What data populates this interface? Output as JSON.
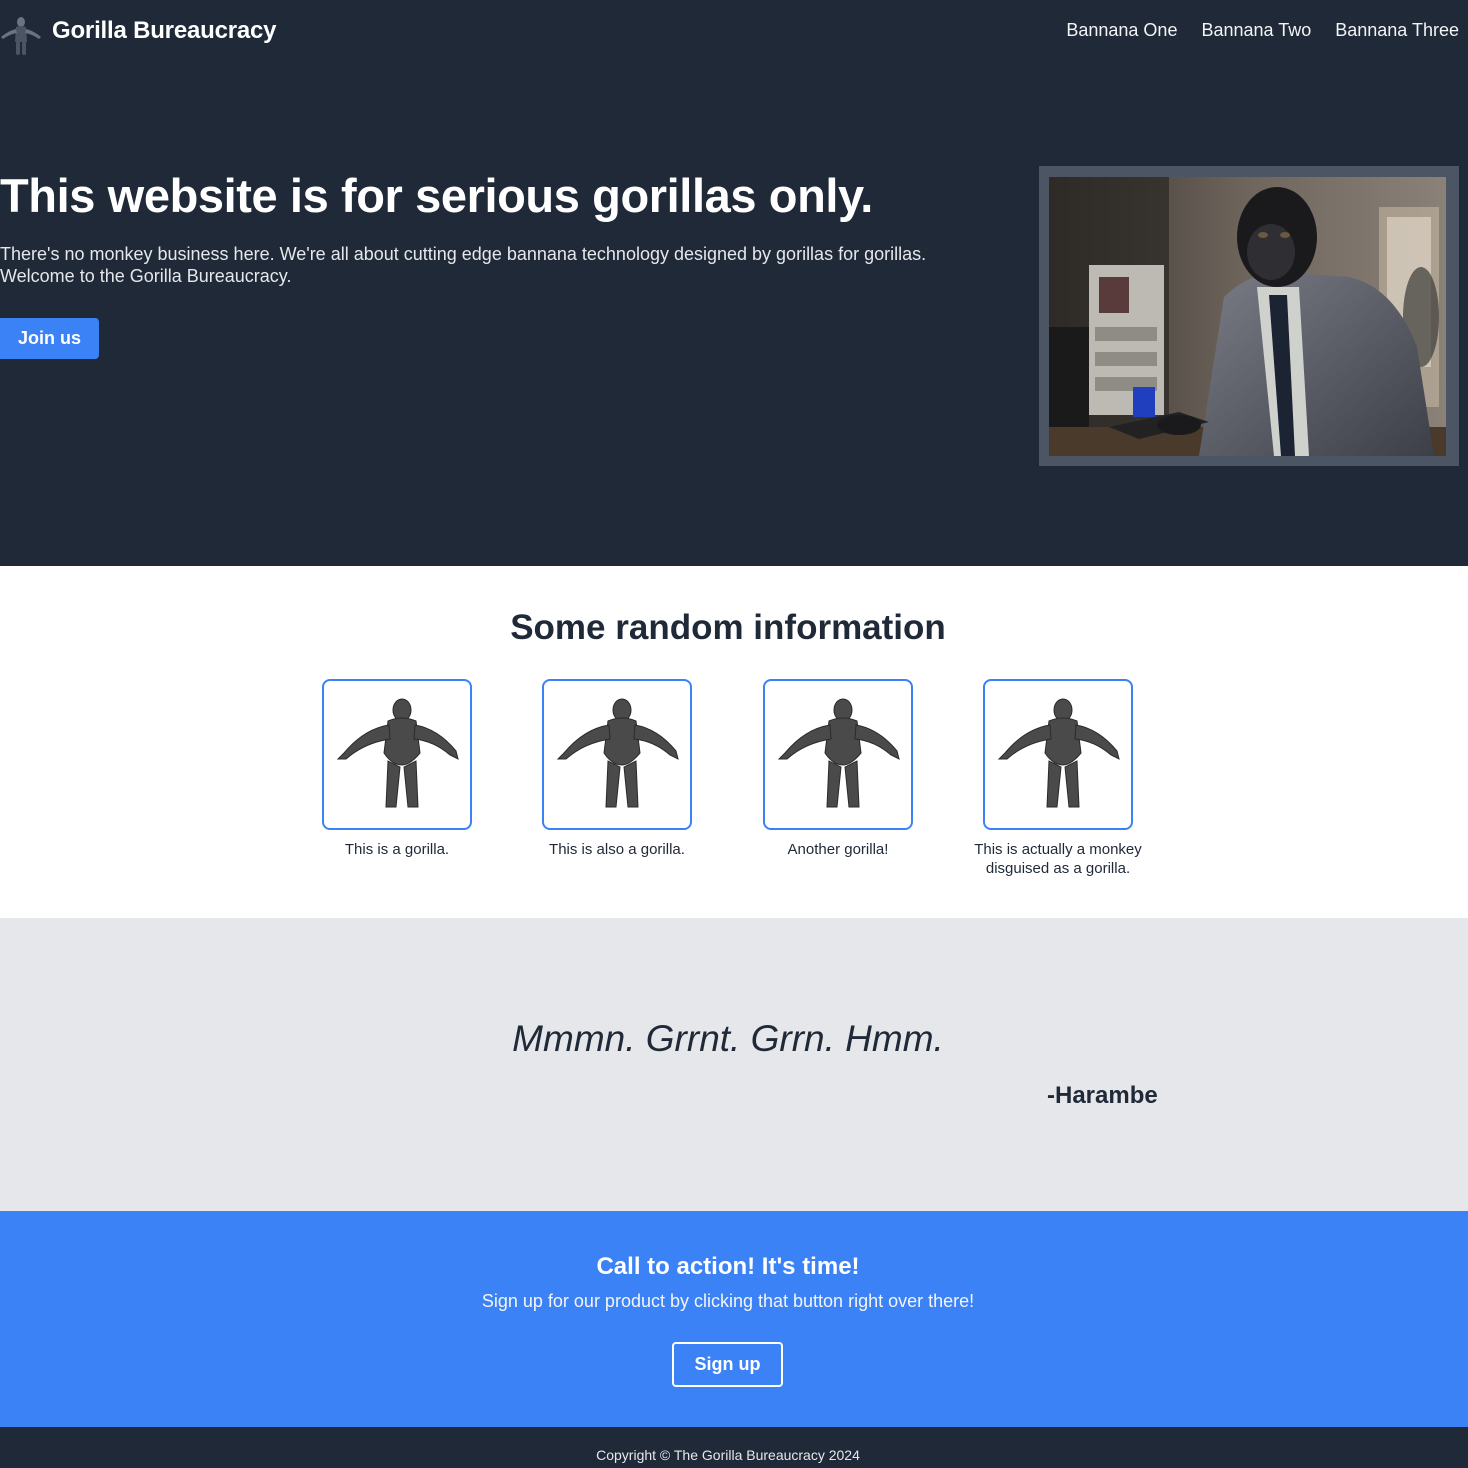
{
  "colors": {
    "dark": "#1f2937",
    "accent": "#3b82f6",
    "light_gray": "#e5e7eb",
    "white": "#ffffff"
  },
  "header": {
    "logo_icon": "gorilla-icon",
    "brand": "Gorilla Bureaucracy",
    "nav": [
      "Bannana One",
      "Bannana Two",
      "Bannana Three"
    ]
  },
  "hero": {
    "title": "This website is for serious gorillas only.",
    "text_line1": "There's no monkey business here. We're all about cutting edge bannana technology designed by gorillas for gorillas.",
    "text_line2": "Welcome to the Gorilla Bureaucracy.",
    "button": "Join us",
    "image": "gorilla-in-suit-photo"
  },
  "info": {
    "title": "Some random information",
    "cards": [
      {
        "icon": "gorilla-model-icon",
        "caption": "This is a gorilla."
      },
      {
        "icon": "gorilla-model-icon",
        "caption": "This is also a gorilla."
      },
      {
        "icon": "gorilla-model-icon",
        "caption": "Another gorilla!"
      },
      {
        "icon": "gorilla-model-icon",
        "caption": "This is actually a monkey disguised as a gorilla."
      }
    ]
  },
  "quote": {
    "text": "Mmmn. Grrnt. Grrn. Hmm.",
    "author": "-Harambe"
  },
  "cta": {
    "title": "Call to action! It's time!",
    "subtitle": "Sign up for our product by clicking that button right over there!",
    "button": "Sign up"
  },
  "footer": {
    "text": "Copyright © The Gorilla Bureaucracy 2024"
  }
}
